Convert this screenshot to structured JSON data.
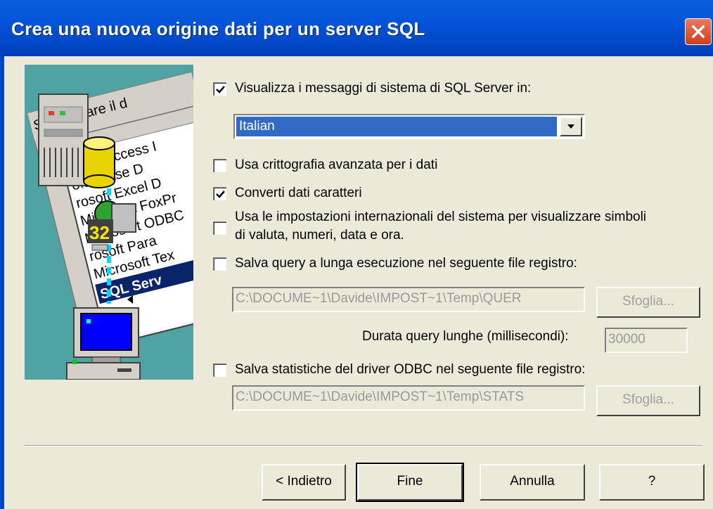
{
  "window": {
    "title": "Crea una nuova origine dati per un server SQL"
  },
  "illustration": {
    "header_text": "Selezionare il d",
    "column_text": "me",
    "list_items": [
      "rosoft Access I",
      "oft dBase D",
      "rosoft Excel D",
      "Microsoft FoxPr",
      "Microsoft ODBC",
      "rosoft Para",
      "Microsoft Tex",
      "SQL Serv"
    ],
    "badge": "32"
  },
  "options": {
    "messages": {
      "label": "Visualizza i messaggi di sistema di SQL Server in:",
      "checked": true
    },
    "language_select": {
      "value": "Italian"
    },
    "encryption": {
      "label": "Usa crittografia avanzata per i dati",
      "checked": false
    },
    "convert_chars": {
      "label": "Converti dati caratteri",
      "checked": true
    },
    "regional": {
      "label_line1": "Usa le impostazioni internazionali del sistema per visualizzare simboli",
      "label_line2": "di valuta, numeri, data e ora.",
      "checked": false
    },
    "long_queries": {
      "label": "Salva query a lunga esecuzione nel seguente file registro:",
      "checked": false
    },
    "long_queries_path": "C:\\DOCUME~1\\Davide\\IMPOST~1\\Temp\\QUER",
    "browse1": "Sfoglia...",
    "duration_label": "Durata query lunghe (millisecondi):",
    "duration_value": "30000",
    "stats": {
      "label": "Salva statistiche del driver ODBC nel seguente file registro:",
      "checked": false
    },
    "stats_path": "C:\\DOCUME~1\\Davide\\IMPOST~1\\Temp\\STATS",
    "browse2": "Sfoglia..."
  },
  "buttons": {
    "back": "< Indietro",
    "finish": "Fine",
    "cancel": "Annulla",
    "help": "?"
  }
}
